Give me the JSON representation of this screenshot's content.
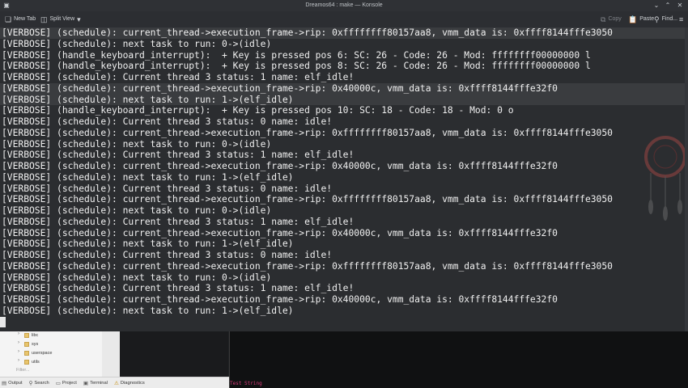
{
  "window": {
    "title": "Dreamos64 : make — Konsole"
  },
  "toolbar": {
    "new_tab": "New Tab",
    "split_view": "Split View",
    "copy": "Copy",
    "paste": "Paste",
    "find": "Find..."
  },
  "terminal": {
    "highlight_rows": [
      0,
      7
    ],
    "lines": [
      "[VERBOSE] (schedule): current_thread->execution_frame->rip: 0xffffffff80157aa8, vmm_data is: 0xffff8144fffe3050",
      "[VERBOSE] (schedule): next task to run: 0->(idle)",
      "[VERBOSE] (handle_keyboard_interrupt):  + Key is pressed pos 6: SC: 26 - Code: 26 - Mod: ffffffff00000000 l",
      "[VERBOSE] (handle_keyboard_interrupt):  + Key is pressed pos 8: SC: 26 - Code: 26 - Mod: ffffffff00000000 l",
      "[VERBOSE] (schedule): Current thread 3 status: 1 name: elf_idle!",
      "[VERBOSE] (schedule): current_thread->execution_frame->rip: 0x40000c, vmm_data is: 0xffff8144fffe32f0",
      "[VERBOSE] (schedule): next task to run: 1->(elf_idle)",
      "[VERBOSE] (handle_keyboard_interrupt):  + Key is pressed pos 10: SC: 18 - Code: 18 - Mod: 0 o",
      "[VERBOSE] (schedule): Current thread 3 status: 0 name: idle!",
      "[VERBOSE] (schedule): current_thread->execution_frame->rip: 0xffffffff80157aa8, vmm_data is: 0xffff8144fffe3050",
      "[VERBOSE] (schedule): next task to run: 0->(idle)",
      "[VERBOSE] (schedule): Current thread 3 status: 1 name: elf_idle!",
      "[VERBOSE] (schedule): current_thread->execution_frame->rip: 0x40000c, vmm_data is: 0xffff8144fffe32f0",
      "[VERBOSE] (schedule): next task to run: 1->(elf_idle)",
      "[VERBOSE] (schedule): Current thread 3 status: 0 name: idle!",
      "[VERBOSE] (schedule): current_thread->execution_frame->rip: 0xffffffff80157aa8, vmm_data is: 0xffff8144fffe3050",
      "[VERBOSE] (schedule): next task to run: 0->(idle)",
      "[VERBOSE] (schedule): Current thread 3 status: 1 name: elf_idle!",
      "[VERBOSE] (schedule): current_thread->execution_frame->rip: 0x40000c, vmm_data is: 0xffff8144fffe32f0",
      "[VERBOSE] (schedule): next task to run: 1->(elf_idle)",
      "[VERBOSE] (schedule): Current thread 3 status: 0 name: idle!",
      "[VERBOSE] (schedule): current_thread->execution_frame->rip: 0xffffffff80157aa8, vmm_data is: 0xffff8144fffe3050",
      "[VERBOSE] (schedule): next task to run: 0->(idle)",
      "[VERBOSE] (schedule): Current thread 3 status: 1 name: elf_idle!",
      "[VERBOSE] (schedule): current_thread->execution_frame->rip: 0x40000c, vmm_data is: 0xffff8144fffe32f0",
      "[VERBOSE] (schedule): next task to run: 1->(elf_idle)"
    ]
  },
  "ide": {
    "tree_items": [
      "libc",
      "sys",
      "userspace",
      "utils"
    ],
    "filter_placeholder": "Filter...",
    "status_items": {
      "output": "Output",
      "search": "Search",
      "project": "Project",
      "terminal": "Terminal",
      "diagnostics": "Diagnostics"
    },
    "console_text": "Test String"
  }
}
